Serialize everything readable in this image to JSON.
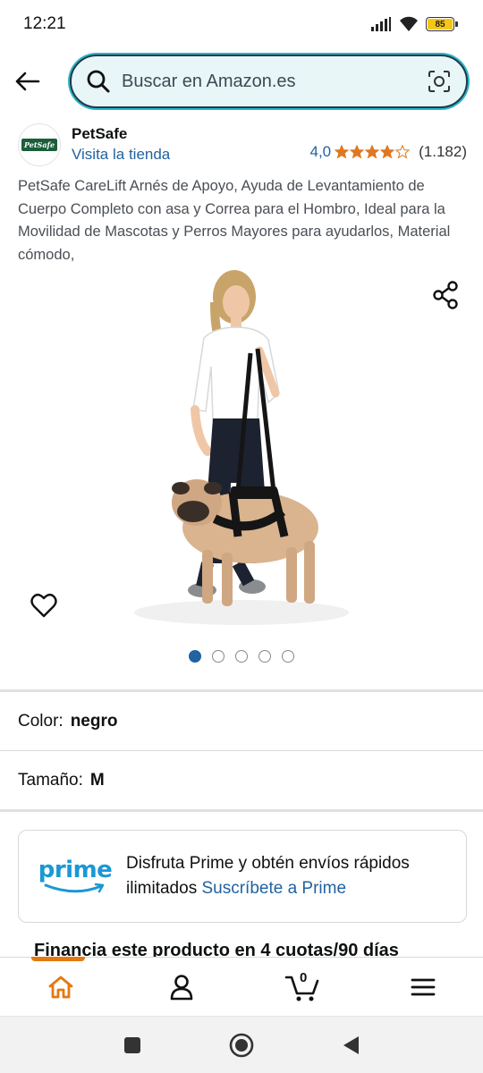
{
  "status_bar": {
    "time": "12:21",
    "battery": "85"
  },
  "search": {
    "placeholder": "Buscar en Amazon.es"
  },
  "brand": {
    "logo_text": "PetSafe",
    "name": "PetSafe",
    "store_link": "Visita la tienda",
    "rating_value": "4,0",
    "rating_stars": 4,
    "rating_count": "(1.182)"
  },
  "product": {
    "title": "PetSafe CareLift Arnés de Apoyo, Ayuda de Levantamiento de Cuerpo Completo con asa y Correa para el Hombro, Ideal para la Movilidad de Mascotas y Perros Mayores para ayudarlos, Material cómodo,",
    "image_count": 5,
    "active_image": 1
  },
  "variations": {
    "color_label": "Color:",
    "color_value": "negro",
    "size_label": "Tamaño:",
    "size_value": "M"
  },
  "prime": {
    "logo_word": "prime",
    "text": "Disfruta Prime y obtén envíos rápidos ilimitados",
    "link": "Suscríbete a Prime"
  },
  "financing": {
    "text": "Financia este producto en 4 cuotas/90 días"
  },
  "bottom_nav": {
    "cart_count": "0"
  },
  "colors": {
    "accent_orange": "#e47911",
    "link_blue": "#2162a1",
    "prime_blue": "#1a98d5",
    "star_orange": "#de7921"
  }
}
